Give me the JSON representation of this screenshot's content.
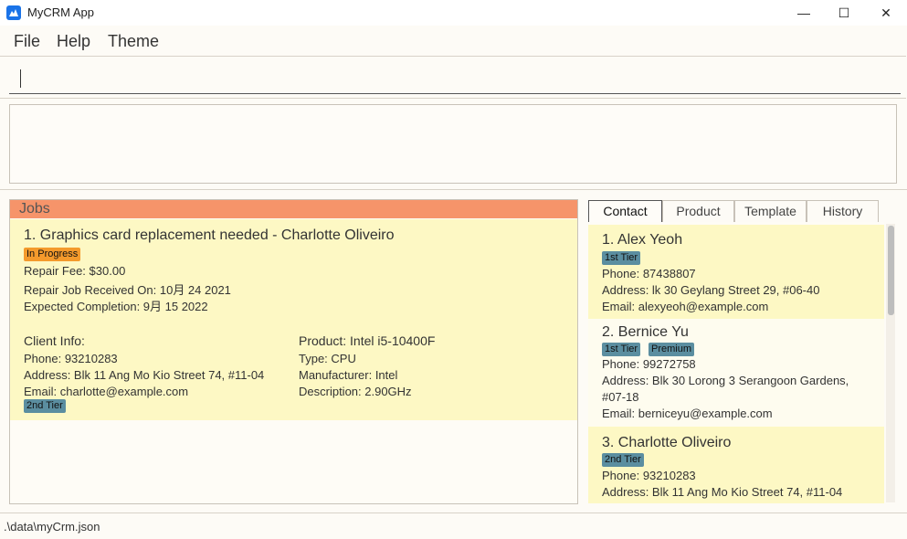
{
  "window": {
    "title": "MyCRM App",
    "minimize": "—",
    "maximize": "☐",
    "close": "✕"
  },
  "menu": {
    "file": "File",
    "help": "Help",
    "theme": "Theme"
  },
  "command": {
    "value": ""
  },
  "result": {
    "text": ""
  },
  "jobs": {
    "header": "Jobs",
    "items": [
      {
        "title": "1. Graphics card replacement needed - Charlotte Oliveiro",
        "status": "In Progress",
        "fee": "Repair Fee: $30.00",
        "received": "Repair Job Received On: 10月 24 2021",
        "expected": "Expected Completion: 9月 15 2022",
        "client_header": "Client Info:",
        "client_phone": "Phone: 93210283",
        "client_address": "Address: Blk 11 Ang Mo Kio Street 74, #11-04",
        "client_email": "Email: charlotte@example.com",
        "client_tier": "2nd Tier",
        "product_header": "Product: Intel i5-10400F",
        "product_type": "Type: CPU",
        "product_manufacturer": "Manufacturer: Intel",
        "product_description": "Description: 2.90GHz"
      }
    ]
  },
  "tabs": [
    "Contact",
    "Product",
    "Template",
    "History"
  ],
  "contacts": [
    {
      "name": "1.  Alex Yeoh",
      "tags": [
        "1st Tier"
      ],
      "phone": "Phone: 87438807",
      "address": "Address: lk 30 Geylang Street 29, #06-40",
      "email": "Email: alexyeoh@example.com"
    },
    {
      "name": "2.  Bernice Yu",
      "tags": [
        "1st Tier",
        "Premium"
      ],
      "phone": "Phone: 99272758",
      "address_line1": "Address: Blk 30 Lorong 3 Serangoon Gardens,",
      "address_line2": "#07-18",
      "email": "Email: berniceyu@example.com"
    },
    {
      "name": "3.  Charlotte Oliveiro",
      "tags": [
        "2nd Tier"
      ],
      "phone": "Phone: 93210283",
      "address": "Address: Blk 11 Ang Mo Kio Street 74, #11-04"
    }
  ],
  "status_bar": {
    "path": ".\\data\\myCrm.json"
  },
  "colors": {
    "jobs_header": "#f6946a",
    "card_yellow": "#fdf8c4",
    "badge_orange": "#f49a2c",
    "badge_teal": "#5b8ea0"
  }
}
